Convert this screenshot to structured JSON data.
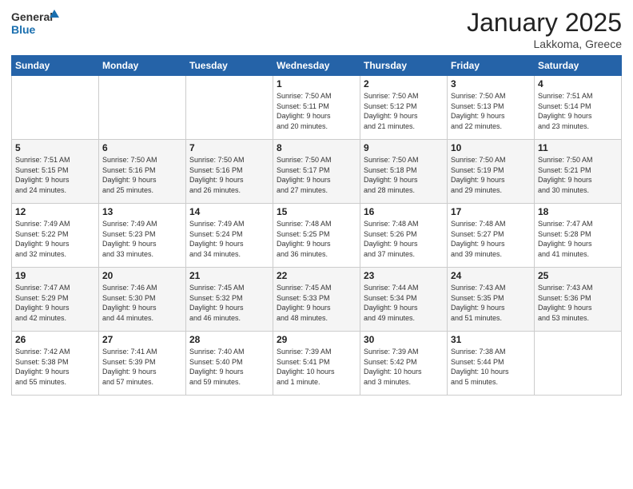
{
  "logo": {
    "general": "General",
    "blue": "Blue"
  },
  "header": {
    "month": "January 2025",
    "location": "Lakkoma, Greece"
  },
  "weekdays": [
    "Sunday",
    "Monday",
    "Tuesday",
    "Wednesday",
    "Thursday",
    "Friday",
    "Saturday"
  ],
  "weeks": [
    [
      {
        "day": "",
        "info": ""
      },
      {
        "day": "",
        "info": ""
      },
      {
        "day": "",
        "info": ""
      },
      {
        "day": "1",
        "info": "Sunrise: 7:50 AM\nSunset: 5:11 PM\nDaylight: 9 hours\nand 20 minutes."
      },
      {
        "day": "2",
        "info": "Sunrise: 7:50 AM\nSunset: 5:12 PM\nDaylight: 9 hours\nand 21 minutes."
      },
      {
        "day": "3",
        "info": "Sunrise: 7:50 AM\nSunset: 5:13 PM\nDaylight: 9 hours\nand 22 minutes."
      },
      {
        "day": "4",
        "info": "Sunrise: 7:51 AM\nSunset: 5:14 PM\nDaylight: 9 hours\nand 23 minutes."
      }
    ],
    [
      {
        "day": "5",
        "info": "Sunrise: 7:51 AM\nSunset: 5:15 PM\nDaylight: 9 hours\nand 24 minutes."
      },
      {
        "day": "6",
        "info": "Sunrise: 7:50 AM\nSunset: 5:16 PM\nDaylight: 9 hours\nand 25 minutes."
      },
      {
        "day": "7",
        "info": "Sunrise: 7:50 AM\nSunset: 5:16 PM\nDaylight: 9 hours\nand 26 minutes."
      },
      {
        "day": "8",
        "info": "Sunrise: 7:50 AM\nSunset: 5:17 PM\nDaylight: 9 hours\nand 27 minutes."
      },
      {
        "day": "9",
        "info": "Sunrise: 7:50 AM\nSunset: 5:18 PM\nDaylight: 9 hours\nand 28 minutes."
      },
      {
        "day": "10",
        "info": "Sunrise: 7:50 AM\nSunset: 5:19 PM\nDaylight: 9 hours\nand 29 minutes."
      },
      {
        "day": "11",
        "info": "Sunrise: 7:50 AM\nSunset: 5:21 PM\nDaylight: 9 hours\nand 30 minutes."
      }
    ],
    [
      {
        "day": "12",
        "info": "Sunrise: 7:49 AM\nSunset: 5:22 PM\nDaylight: 9 hours\nand 32 minutes."
      },
      {
        "day": "13",
        "info": "Sunrise: 7:49 AM\nSunset: 5:23 PM\nDaylight: 9 hours\nand 33 minutes."
      },
      {
        "day": "14",
        "info": "Sunrise: 7:49 AM\nSunset: 5:24 PM\nDaylight: 9 hours\nand 34 minutes."
      },
      {
        "day": "15",
        "info": "Sunrise: 7:48 AM\nSunset: 5:25 PM\nDaylight: 9 hours\nand 36 minutes."
      },
      {
        "day": "16",
        "info": "Sunrise: 7:48 AM\nSunset: 5:26 PM\nDaylight: 9 hours\nand 37 minutes."
      },
      {
        "day": "17",
        "info": "Sunrise: 7:48 AM\nSunset: 5:27 PM\nDaylight: 9 hours\nand 39 minutes."
      },
      {
        "day": "18",
        "info": "Sunrise: 7:47 AM\nSunset: 5:28 PM\nDaylight: 9 hours\nand 41 minutes."
      }
    ],
    [
      {
        "day": "19",
        "info": "Sunrise: 7:47 AM\nSunset: 5:29 PM\nDaylight: 9 hours\nand 42 minutes."
      },
      {
        "day": "20",
        "info": "Sunrise: 7:46 AM\nSunset: 5:30 PM\nDaylight: 9 hours\nand 44 minutes."
      },
      {
        "day": "21",
        "info": "Sunrise: 7:45 AM\nSunset: 5:32 PM\nDaylight: 9 hours\nand 46 minutes."
      },
      {
        "day": "22",
        "info": "Sunrise: 7:45 AM\nSunset: 5:33 PM\nDaylight: 9 hours\nand 48 minutes."
      },
      {
        "day": "23",
        "info": "Sunrise: 7:44 AM\nSunset: 5:34 PM\nDaylight: 9 hours\nand 49 minutes."
      },
      {
        "day": "24",
        "info": "Sunrise: 7:43 AM\nSunset: 5:35 PM\nDaylight: 9 hours\nand 51 minutes."
      },
      {
        "day": "25",
        "info": "Sunrise: 7:43 AM\nSunset: 5:36 PM\nDaylight: 9 hours\nand 53 minutes."
      }
    ],
    [
      {
        "day": "26",
        "info": "Sunrise: 7:42 AM\nSunset: 5:38 PM\nDaylight: 9 hours\nand 55 minutes."
      },
      {
        "day": "27",
        "info": "Sunrise: 7:41 AM\nSunset: 5:39 PM\nDaylight: 9 hours\nand 57 minutes."
      },
      {
        "day": "28",
        "info": "Sunrise: 7:40 AM\nSunset: 5:40 PM\nDaylight: 9 hours\nand 59 minutes."
      },
      {
        "day": "29",
        "info": "Sunrise: 7:39 AM\nSunset: 5:41 PM\nDaylight: 10 hours\nand 1 minute."
      },
      {
        "day": "30",
        "info": "Sunrise: 7:39 AM\nSunset: 5:42 PM\nDaylight: 10 hours\nand 3 minutes."
      },
      {
        "day": "31",
        "info": "Sunrise: 7:38 AM\nSunset: 5:44 PM\nDaylight: 10 hours\nand 5 minutes."
      },
      {
        "day": "",
        "info": ""
      }
    ]
  ]
}
